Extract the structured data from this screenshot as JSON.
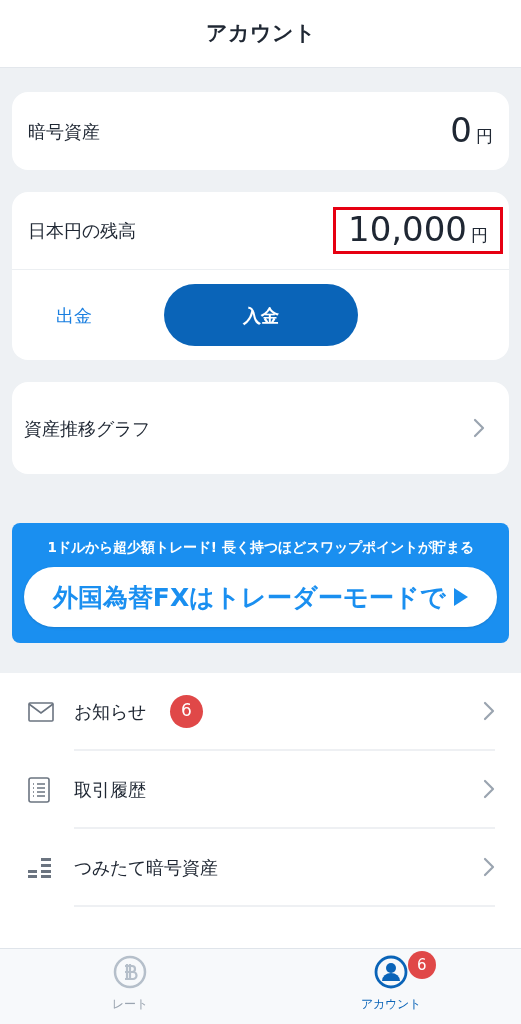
{
  "header": {
    "title": "アカウント"
  },
  "crypto": {
    "label": "暗号資産",
    "amount": "0",
    "unit": "円"
  },
  "yen": {
    "label": "日本円の残高",
    "amount": "10,000",
    "unit": "円",
    "highlighted": true,
    "withdraw": "出金",
    "deposit": "入金"
  },
  "graph": {
    "label": "資産推移グラフ"
  },
  "banner": {
    "caption": "1ドルから超少額トレード! 長く持つほどスワップポイントが貯まる",
    "button": "外国為替FXはトレーダーモードで"
  },
  "menu": [
    {
      "kind": "mail",
      "label": "お知らせ",
      "badge": "6"
    },
    {
      "kind": "list",
      "label": "取引履歴"
    },
    {
      "kind": "bars",
      "label": "つみたて暗号資産"
    }
  ],
  "tabs": [
    {
      "kind": "coin",
      "label": "レート",
      "selected": false
    },
    {
      "kind": "person",
      "label": "アカウント",
      "selected": true,
      "badge": "6"
    }
  ]
}
